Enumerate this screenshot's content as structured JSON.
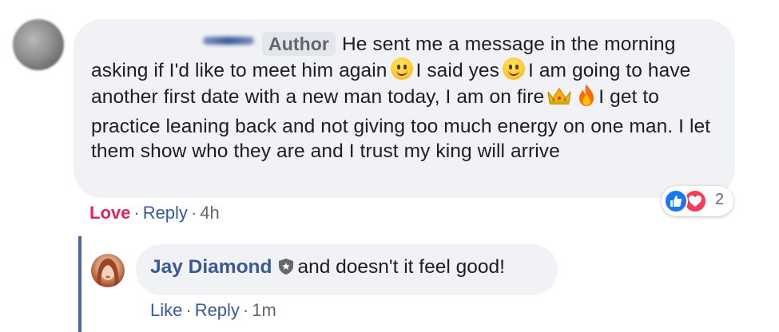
{
  "comment": {
    "author_badge": "Author",
    "text_line1": "He sent me a message in the",
    "text_part2": "morning asking if I'd like to meet him again",
    "text_part3": "I said yes",
    "text_part4": "I am going to have another first date with a new man today, I am on fire",
    "text_part5": "I get to practice leaning back and not giving too much energy on one man. I let them show who they are and I trust my king will arrive",
    "reaction_count": "2",
    "action_react": "Love",
    "action_reply": "Reply",
    "time": "4h"
  },
  "reply": {
    "name": "Jay Diamond",
    "text": "and doesn't it feel good!",
    "action_like": "Like",
    "action_reply": "Reply",
    "time": "1m"
  },
  "colors": {
    "bubble": "#f0f2f5",
    "link": "#385898",
    "love": "#e0245e",
    "like_reaction": "#1877f2",
    "love_reaction": "#f33e58"
  }
}
